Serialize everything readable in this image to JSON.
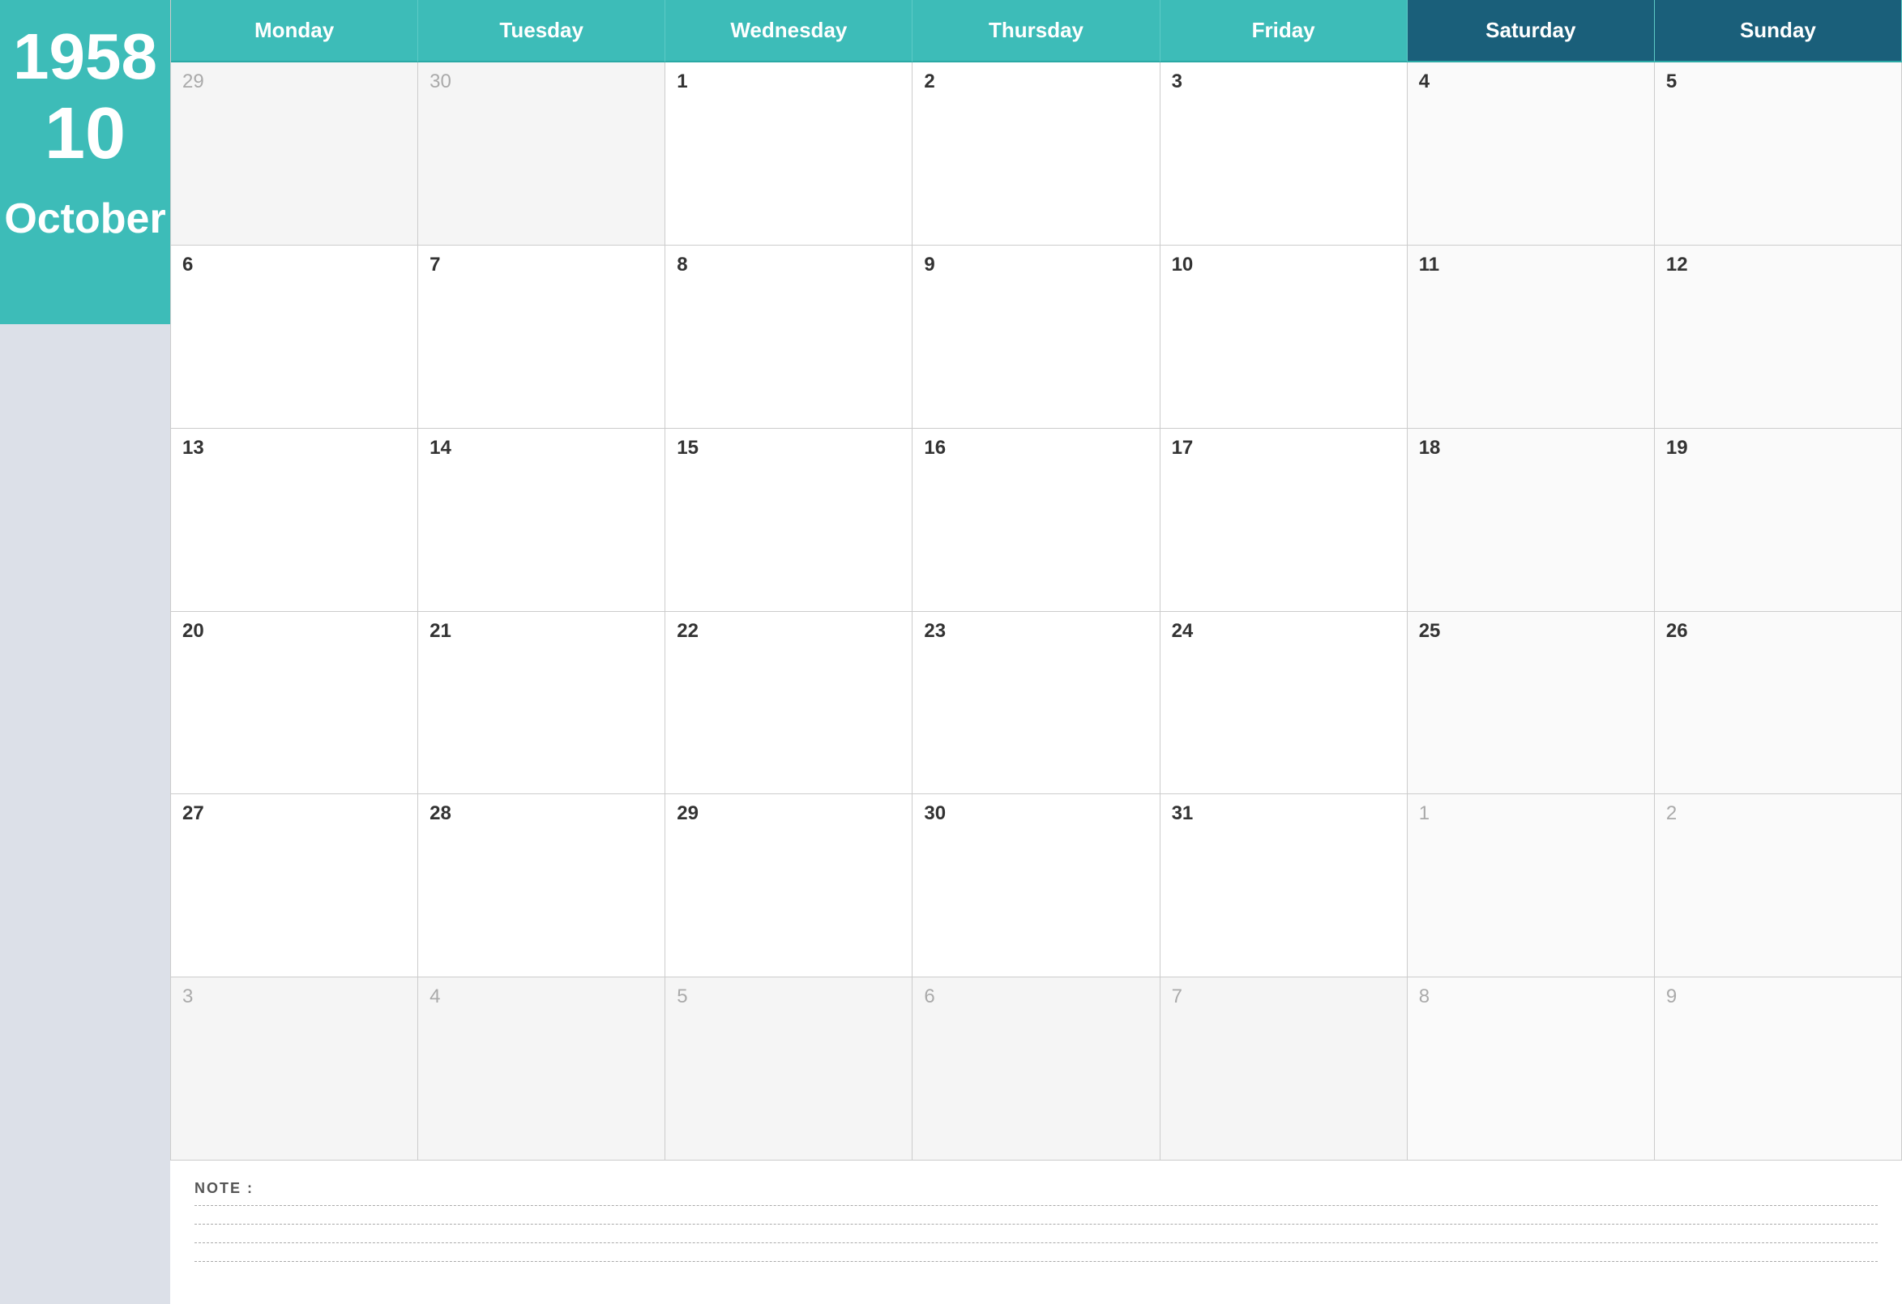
{
  "sidebar": {
    "year": "1958",
    "month_num": "10",
    "month_name": "October"
  },
  "header": {
    "days": [
      {
        "label": "Monday",
        "type": "weekday"
      },
      {
        "label": "Tuesday",
        "type": "weekday"
      },
      {
        "label": "Wednesday",
        "type": "weekday"
      },
      {
        "label": "Thursday",
        "type": "weekday"
      },
      {
        "label": "Friday",
        "type": "weekday"
      },
      {
        "label": "Saturday",
        "type": "weekend"
      },
      {
        "label": "Sunday",
        "type": "weekend"
      }
    ]
  },
  "weeks": [
    [
      {
        "day": "29",
        "type": "other"
      },
      {
        "day": "30",
        "type": "other"
      },
      {
        "day": "1",
        "type": "current"
      },
      {
        "day": "2",
        "type": "current"
      },
      {
        "day": "3",
        "type": "current"
      },
      {
        "day": "4",
        "type": "current"
      },
      {
        "day": "5",
        "type": "current"
      }
    ],
    [
      {
        "day": "6",
        "type": "current"
      },
      {
        "day": "7",
        "type": "current"
      },
      {
        "day": "8",
        "type": "current"
      },
      {
        "day": "9",
        "type": "current"
      },
      {
        "day": "10",
        "type": "current"
      },
      {
        "day": "11",
        "type": "current"
      },
      {
        "day": "12",
        "type": "current"
      }
    ],
    [
      {
        "day": "13",
        "type": "current"
      },
      {
        "day": "14",
        "type": "current"
      },
      {
        "day": "15",
        "type": "current"
      },
      {
        "day": "16",
        "type": "current"
      },
      {
        "day": "17",
        "type": "current"
      },
      {
        "day": "18",
        "type": "current"
      },
      {
        "day": "19",
        "type": "current"
      }
    ],
    [
      {
        "day": "20",
        "type": "current"
      },
      {
        "day": "21",
        "type": "current"
      },
      {
        "day": "22",
        "type": "current"
      },
      {
        "day": "23",
        "type": "current"
      },
      {
        "day": "24",
        "type": "current"
      },
      {
        "day": "25",
        "type": "current"
      },
      {
        "day": "26",
        "type": "current"
      }
    ],
    [
      {
        "day": "27",
        "type": "current"
      },
      {
        "day": "28",
        "type": "current"
      },
      {
        "day": "29",
        "type": "current"
      },
      {
        "day": "30",
        "type": "current"
      },
      {
        "day": "31",
        "type": "current"
      },
      {
        "day": "1",
        "type": "other"
      },
      {
        "day": "2",
        "type": "other"
      }
    ],
    [
      {
        "day": "3",
        "type": "other"
      },
      {
        "day": "4",
        "type": "other"
      },
      {
        "day": "5",
        "type": "other"
      },
      {
        "day": "6",
        "type": "other"
      },
      {
        "day": "7",
        "type": "other"
      },
      {
        "day": "8",
        "type": "other"
      },
      {
        "day": "9",
        "type": "other"
      }
    ]
  ],
  "notes": {
    "label": "NOTE :",
    "lines": 4
  }
}
